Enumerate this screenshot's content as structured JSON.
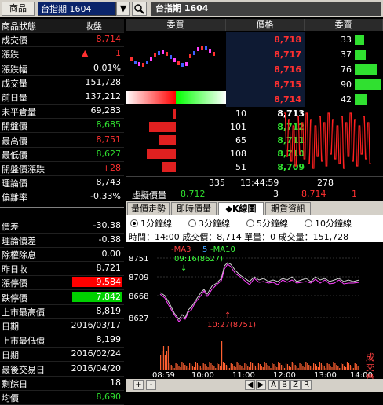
{
  "toolbar": {
    "product_tab": "商品",
    "symbol_value": "台指期 1604",
    "dropdown": "▼",
    "title": "台指期  1604"
  },
  "left_header": {
    "label": "商品狀態",
    "value": "收盤"
  },
  "left_rows": [
    {
      "label": "成交價",
      "value": "8,714",
      "color": "red"
    },
    {
      "label": "漲跌",
      "value": "1",
      "color": "red",
      "arrow": "▲"
    },
    {
      "label": "漲跌幅",
      "value": "0.01%",
      "color": "white"
    },
    {
      "label": "成交量",
      "value": "151,728",
      "color": "white"
    },
    {
      "label": "前日量",
      "value": "137,212",
      "color": "white"
    },
    {
      "label": "未平倉量",
      "value": "69,283",
      "color": "white"
    },
    {
      "label": "開盤價",
      "value": "8,685",
      "color": "green"
    },
    {
      "label": "最高價",
      "value": "8,751",
      "color": "red"
    },
    {
      "label": "最低價",
      "value": "8,627",
      "color": "green"
    },
    {
      "label": "開盤價漲跌",
      "value": "+28",
      "color": "red"
    },
    {
      "label": "理論價",
      "value": "8,743",
      "color": "white"
    },
    {
      "label": "偏離率",
      "value": "-0.33%",
      "color": "white"
    }
  ],
  "left_rows2": [
    {
      "label": "價差",
      "value": "-30.38",
      "color": "white"
    },
    {
      "label": "理論價差",
      "value": "-0.38",
      "color": "white"
    },
    {
      "label": "除權除息",
      "value": "0.00",
      "color": "white"
    },
    {
      "label": "昨日收",
      "value": "8,721",
      "color": "white"
    },
    {
      "label": "漲停價",
      "value": "9,584",
      "color": "limitup"
    },
    {
      "label": "跌停價",
      "value": "7,842",
      "color": "limitdown"
    },
    {
      "label": "上市最高價",
      "value": "8,819",
      "color": "white"
    },
    {
      "label": "日期",
      "value": "2016/03/17",
      "color": "white"
    },
    {
      "label": "上市最低價",
      "value": "8,199",
      "color": "white"
    },
    {
      "label": "日期",
      "value": "2016/02/24",
      "color": "white"
    },
    {
      "label": "最後交易日",
      "value": "2016/04/20",
      "color": "white"
    },
    {
      "label": "剩餘日",
      "value": "18",
      "color": "white"
    },
    {
      "label": "均價",
      "value": "8,690",
      "color": "green"
    }
  ],
  "orderbook": {
    "hdr_bid": "委買",
    "hdr_price": "價格",
    "hdr_ask": "委賣",
    "asks": [
      {
        "price": "8,718",
        "qty": "33",
        "ratio": 0.2
      },
      {
        "price": "8,717",
        "qty": "37",
        "ratio": 0.23
      },
      {
        "price": "8,716",
        "qty": "76",
        "ratio": 0.47
      },
      {
        "price": "8,715",
        "qty": "90",
        "ratio": 0.56
      },
      {
        "price": "8,714",
        "qty": "42",
        "ratio": 0.26
      }
    ],
    "bids": [
      {
        "qty": "10",
        "price": "8,713",
        "ratio": 0.08
      },
      {
        "qty": "101",
        "price": "8,712",
        "ratio": 0.78
      },
      {
        "qty": "65",
        "price": "8,711",
        "ratio": 0.5
      },
      {
        "qty": "108",
        "price": "8,710",
        "ratio": 0.84
      },
      {
        "qty": "51",
        "price": "8,709",
        "ratio": 0.4
      }
    ],
    "totals": {
      "bid_total": "335",
      "time": "13:44:59",
      "ask_total": "278"
    },
    "virtual": {
      "label": "虛擬價量",
      "price": "8,712",
      "qty": "3",
      "price2": "8,714",
      "qty2": "1"
    }
  },
  "tabs": [
    "量價走勢",
    "即時價量",
    "◆K線圖",
    "期貨資訊"
  ],
  "chart": {
    "radios": [
      "1分鐘線",
      "3分鐘線",
      "5分鐘線",
      "10分鐘線"
    ],
    "info": "時間：14:00  成交價：8,714  單量：0  成交量：151,728",
    "legend": {
      "ma3": "-MA3",
      "ma5": "5",
      "ma10": "-MA10"
    },
    "annotation_high": "09:16(8627)",
    "annotation_low": "10:27(8751)",
    "price_ticks": [
      "8751",
      "8709",
      "8668",
      "8627"
    ],
    "time_ticks": [
      "08:59",
      "10:00",
      "11:00",
      "12:00",
      "13:00",
      "14:00"
    ],
    "volume_label": "成交量",
    "buttons": [
      "+",
      "-",
      "◀",
      "▶",
      "A",
      "B",
      "Z",
      "R"
    ]
  },
  "colors": {
    "up": "#ff3030",
    "down": "#30e030",
    "limitup_bg": "#ff0000",
    "limitdown_bg": "#00d000"
  }
}
